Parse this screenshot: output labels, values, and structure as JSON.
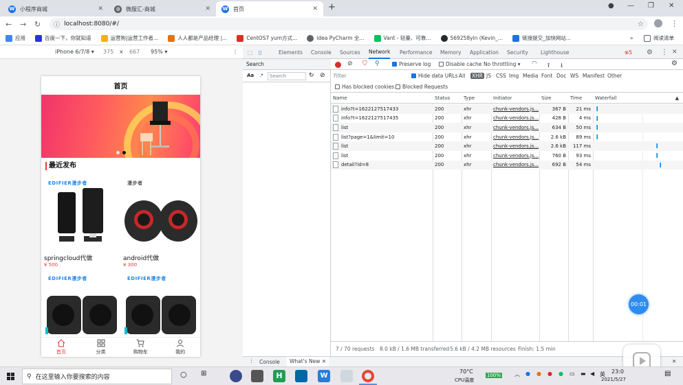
{
  "browser": {
    "tabs": [
      {
        "label": "小程序商城",
        "active": false
      },
      {
        "label": "微服汇-商城",
        "active": false
      },
      {
        "label": "首页",
        "active": true
      }
    ],
    "new_tab": "+",
    "url": "localhost:8080/#/",
    "bookmarks": [
      "应用",
      "百度一下，你就知道",
      "运营狗|运营工作者...",
      "人人都是产品经理 |...",
      "CentOS7 yum方式...",
      "idea PyCharm 全...",
      "Vant - 轻量、可靠...",
      "569258yin (Kevin_...",
      "链接提交_加快网站..."
    ],
    "bookmarks_more": "»",
    "reading_list": "阅读清单"
  },
  "device_toolbar": {
    "device": "iPhone 6/7/8 ▾",
    "width": "375",
    "times": "×",
    "height": "667",
    "zoom": "95% ▾"
  },
  "mobile": {
    "title": "首页",
    "section_title": "最近发布",
    "products": [
      {
        "brand": "EDIFIER漫步者",
        "name": "springcloud代做",
        "price": "¥ 500"
      },
      {
        "brand": "漫步者",
        "name": "android代做",
        "price": "¥ 300"
      },
      {
        "brand": "EDIFIER漫步者",
        "name": "",
        "price": ""
      },
      {
        "brand": "EDIFIER漫步者",
        "name": "",
        "price": ""
      }
    ],
    "tabbar": [
      {
        "label": "首页",
        "icon": "home-icon"
      },
      {
        "label": "分类",
        "icon": "grid-icon"
      },
      {
        "label": "购物车",
        "icon": "cart-icon"
      },
      {
        "label": "我的",
        "icon": "user-icon"
      }
    ]
  },
  "devtools": {
    "tabs": [
      "Elements",
      "Console",
      "Sources",
      "Network",
      "Performance",
      "Memory",
      "Application",
      "Security",
      "Lighthouse"
    ],
    "active_tab": "Network",
    "error_badge": "5",
    "search_title": "Search",
    "search_aa": "Aa",
    "search_regex": ".*",
    "search_placeholder": "Search",
    "preserve_log": "Preserve log",
    "disable_cache": "Disable cache",
    "throttling": "No throttling",
    "filter_placeholder": "Filter",
    "hide_data_urls": "Hide data URLs",
    "type_filters": [
      "All",
      "XHR",
      "JS",
      "CSS",
      "Img",
      "Media",
      "Font",
      "Doc",
      "WS",
      "Manifest",
      "Other"
    ],
    "has_blocked_cookies": "Has blocked cookies",
    "blocked_requests": "Blocked Requests",
    "columns": [
      "Name",
      "Status",
      "Type",
      "Initiator",
      "Size",
      "Time",
      "Waterfall"
    ],
    "rows": [
      {
        "name": "info?t=1622127517433",
        "status": "200",
        "type": "xhr",
        "initiator": "chunk-vendors.js...",
        "size": "367 B",
        "time": "21 ms",
        "wf": 0.01
      },
      {
        "name": "info?t=1622127517435",
        "status": "200",
        "type": "xhr",
        "initiator": "chunk-vendors.js...",
        "size": "428 B",
        "time": "4 ms",
        "wf": 0.01
      },
      {
        "name": "list",
        "status": "200",
        "type": "xhr",
        "initiator": "chunk-vendors.js...",
        "size": "634 B",
        "time": "50 ms",
        "wf": 0.01
      },
      {
        "name": "list?page=1&limit=10",
        "status": "200",
        "type": "xhr",
        "initiator": "chunk-vendors.js...",
        "size": "2.6 kB",
        "time": "89 ms",
        "wf": 0.01
      },
      {
        "name": "list",
        "status": "200",
        "type": "xhr",
        "initiator": "chunk-vendors.js...",
        "size": "2.6 kB",
        "time": "117 ms",
        "wf": 0.73
      },
      {
        "name": "list",
        "status": "200",
        "type": "xhr",
        "initiator": "chunk-vendors.js...",
        "size": "760 B",
        "time": "93 ms",
        "wf": 0.73
      },
      {
        "name": "detail?id=8",
        "status": "200",
        "type": "xhr",
        "initiator": "chunk-vendors.js...",
        "size": "692 B",
        "time": "54 ms",
        "wf": 0.77
      }
    ],
    "status": {
      "requests": "7 / 70 requests",
      "transferred": "8.0 kB / 1.6 MB transferred",
      "resources": "5.6 kB / 4.2 MB resources",
      "finish": "Finish: 1.5 min"
    },
    "drawer_tabs": [
      "Console",
      "What's New"
    ]
  },
  "overlay": {
    "timer": "00:01"
  },
  "taskbar": {
    "search_placeholder": "在这里输入你要搜索的内容",
    "temp": "70°C",
    "cpu_label": "CPU温度",
    "battery": "100%",
    "ime": "英",
    "time": "23:0",
    "date": "2021/5/27"
  }
}
